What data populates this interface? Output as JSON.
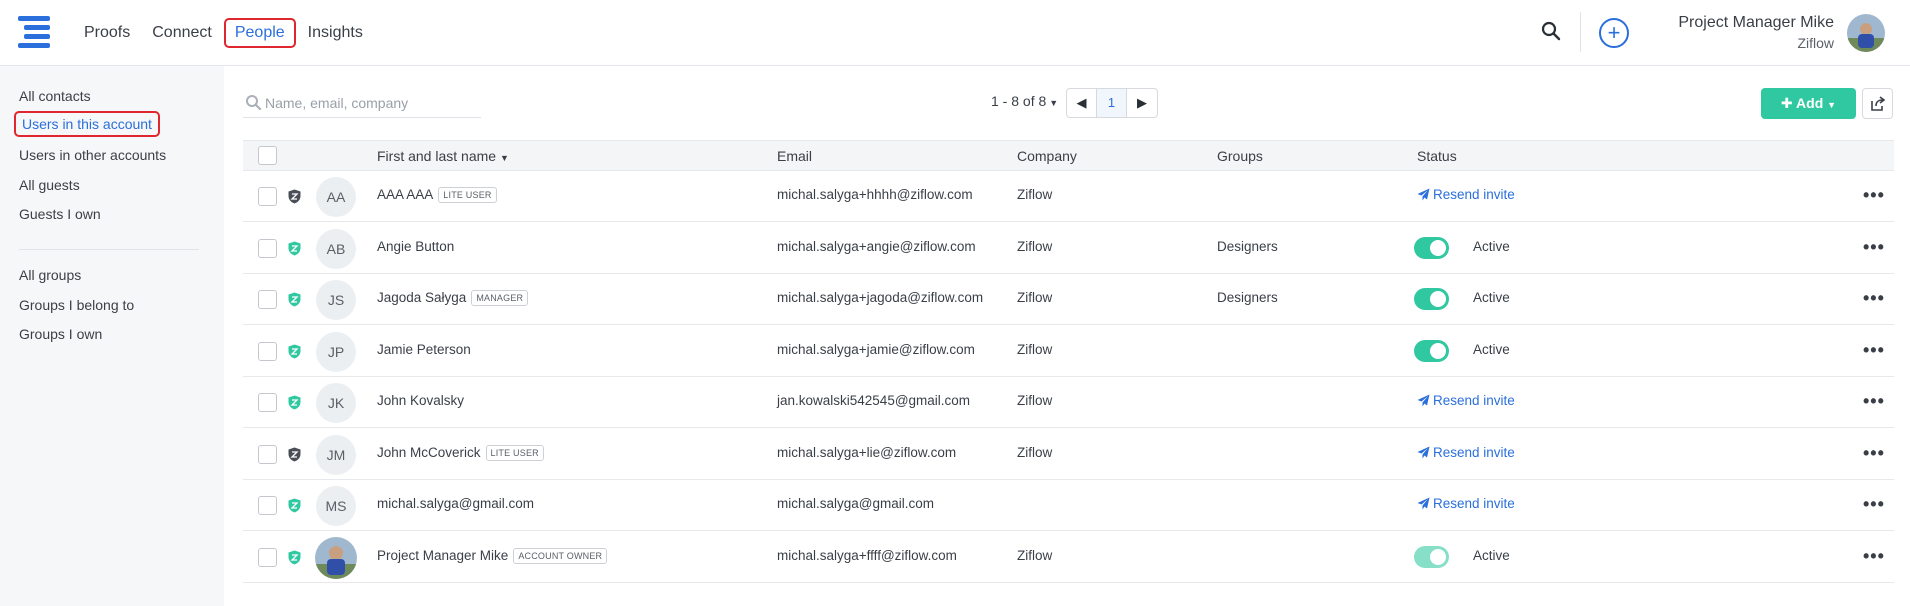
{
  "nav": {
    "items": [
      {
        "label": "Proofs"
      },
      {
        "label": "Connect"
      },
      {
        "label": "People"
      },
      {
        "label": "Insights"
      }
    ],
    "user_name": "Project Manager Mike",
    "user_org": "Ziflow"
  },
  "sidebar": {
    "items": [
      {
        "label": "All contacts"
      },
      {
        "label": "Users in this account"
      },
      {
        "label": "Users in other accounts"
      },
      {
        "label": "All guests"
      },
      {
        "label": "Guests I own"
      },
      {
        "label": "All groups"
      },
      {
        "label": "Groups I belong to"
      },
      {
        "label": "Groups I own"
      }
    ]
  },
  "toolbar": {
    "search_placeholder": "Name, email, company",
    "pager_text": "1 - 8 of 8",
    "page_number": "1",
    "add_label": "Add"
  },
  "table": {
    "headers": {
      "name": "First and last name",
      "email": "Email",
      "company": "Company",
      "groups": "Groups",
      "status": "Status"
    },
    "rows": [
      {
        "initials": "AA",
        "name": "AAA AAA",
        "badge": "LITE USER",
        "email": "michal.salyga+hhhh@ziflow.com",
        "company": "Ziflow",
        "groups": "",
        "status": "Resend invite"
      },
      {
        "initials": "AB",
        "name": "Angie Button",
        "badge": "",
        "email": "michal.salyga+angie@ziflow.com",
        "company": "Ziflow",
        "groups": "Designers",
        "status": "Active"
      },
      {
        "initials": "JS",
        "name": "Jagoda Sałyga",
        "badge": "MANAGER",
        "email": "michal.salyga+jagoda@ziflow.com",
        "company": "Ziflow",
        "groups": "Designers",
        "status": "Active"
      },
      {
        "initials": "JP",
        "name": "Jamie Peterson",
        "badge": "",
        "email": "michal.salyga+jamie@ziflow.com",
        "company": "Ziflow",
        "groups": "",
        "status": "Active"
      },
      {
        "initials": "JK",
        "name": "John Kovalsky",
        "badge": "",
        "email": "jan.kowalski542545@gmail.com",
        "company": "Ziflow",
        "groups": "",
        "status": "Resend invite"
      },
      {
        "initials": "JM",
        "name": "John McCoverick",
        "badge": "LITE USER",
        "email": "michal.salyga+lie@ziflow.com",
        "company": "Ziflow",
        "groups": "",
        "status": "Resend invite"
      },
      {
        "initials": "MS",
        "name": "michal.salyga@gmail.com",
        "badge": "",
        "email": "michal.salyga@gmail.com",
        "company": "",
        "groups": "",
        "status": "Resend invite"
      },
      {
        "initials": "",
        "name": "Project Manager Mike",
        "badge": "ACCOUNT OWNER",
        "email": "michal.salyga+ffff@ziflow.com",
        "company": "Ziflow",
        "groups": "",
        "status": "Active"
      }
    ]
  },
  "colors": {
    "accent": "#2a6fdb",
    "add_button": "#30c8a0",
    "toggle_on": "#30c8a0",
    "highlight_outline": "#e0262e"
  }
}
